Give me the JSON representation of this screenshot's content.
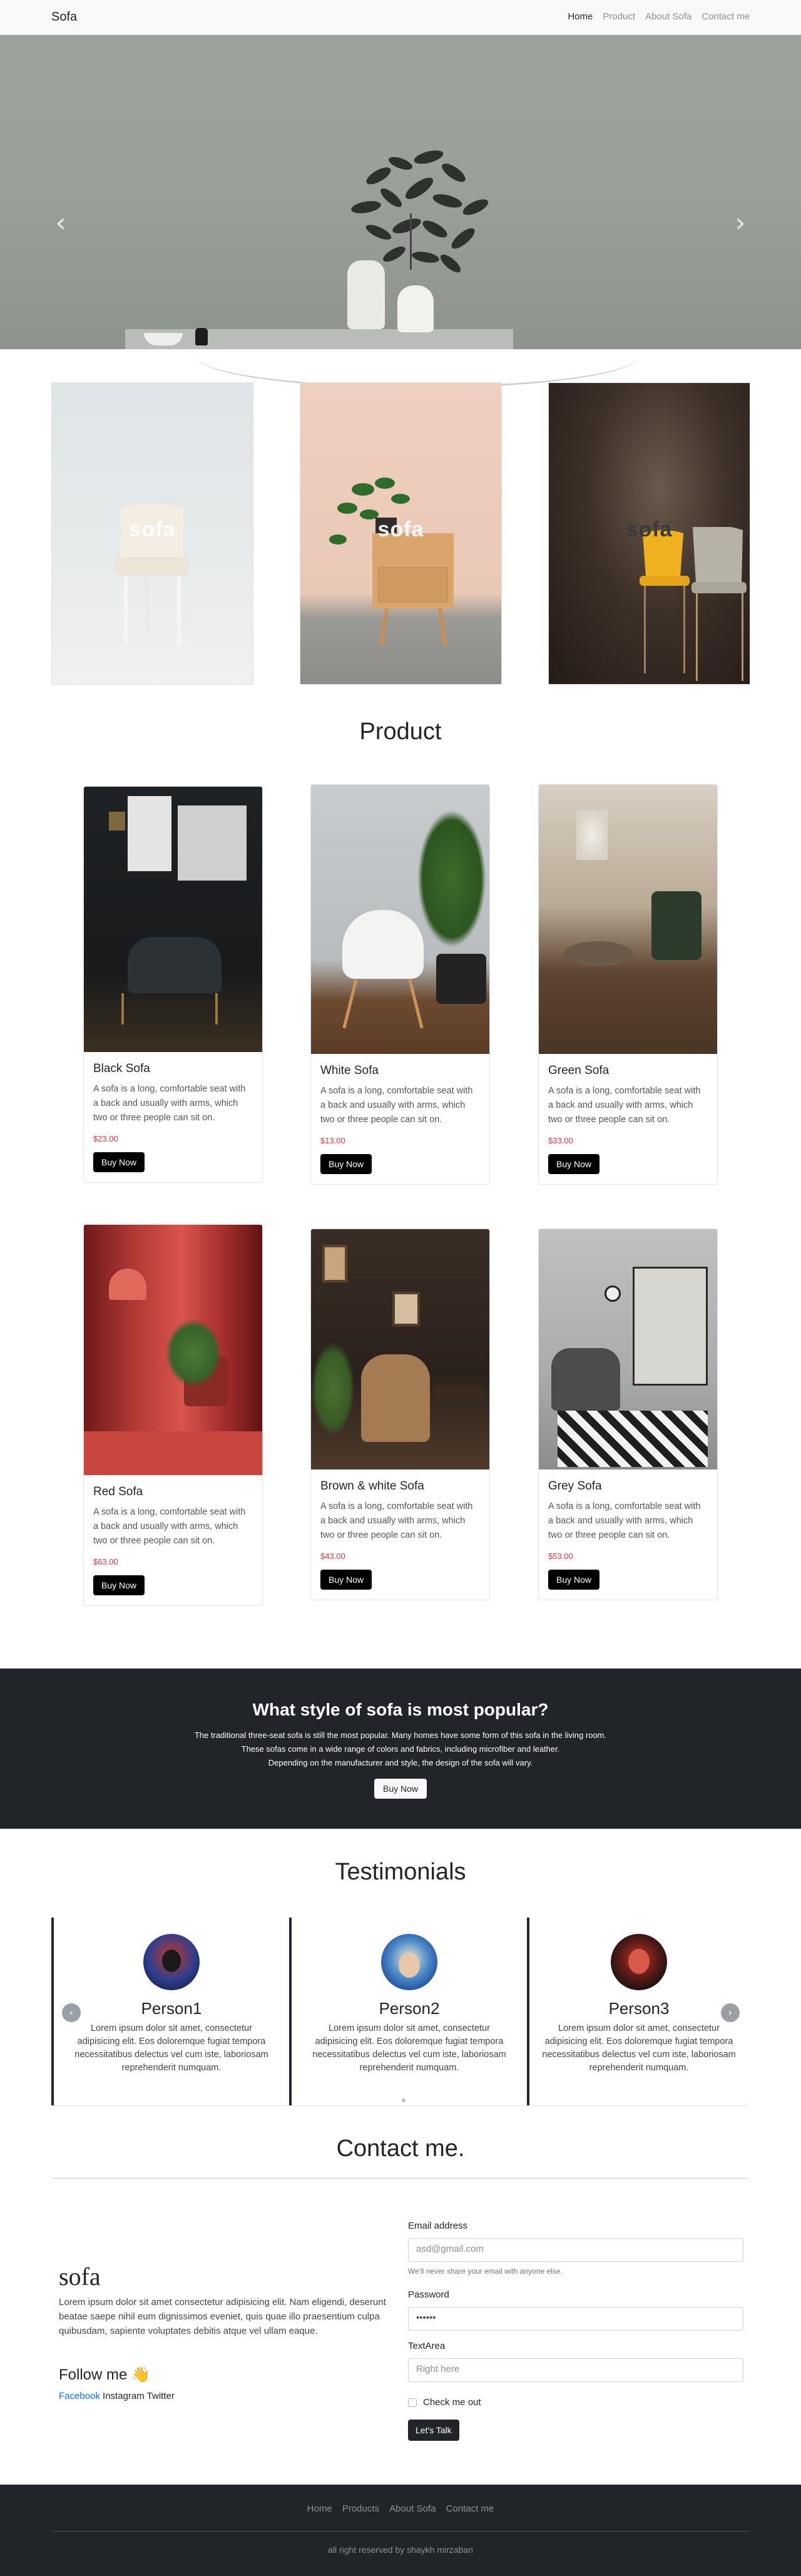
{
  "nav": {
    "brand": "Sofa",
    "links": [
      "Home",
      "Product",
      "About Sofa",
      "Contact me"
    ]
  },
  "hero": {
    "prev_icon": "chevron-left-icon",
    "next_icon": "chevron-right-icon",
    "slides": 4,
    "active_slide": 1
  },
  "categories": [
    {
      "label": "sofa"
    },
    {
      "label": "sofa"
    },
    {
      "label": "sofa"
    }
  ],
  "product": {
    "title": "Product",
    "items": [
      {
        "name": "Black Sofa",
        "desc": "A sofa is a long, comfortable seat with a back and usually with arms, which two or three people can sit on.",
        "price": "$23.00",
        "button": "Buy Now"
      },
      {
        "name": "White Sofa",
        "desc": "A sofa is a long, comfortable seat with a back and usually with arms, which two or three people can sit on.",
        "price": "$13.00",
        "button": "Buy Now"
      },
      {
        "name": "Green Sofa",
        "desc": "A sofa is a long, comfortable seat with a back and usually with arms, which two or three people can sit on.",
        "price": "$33.00",
        "button": "Buy Now"
      },
      {
        "name": "Red Sofa",
        "desc": "A sofa is a long, comfortable seat with a back and usually with arms, which two or three people can sit on.",
        "price": "$63.00",
        "button": "Buy Now"
      },
      {
        "name": "Brown & white Sofa",
        "desc": "A sofa is a long, comfortable seat with a back and usually with arms, which two or three people can sit on.",
        "price": "$43.00",
        "button": "Buy Now"
      },
      {
        "name": "Grey Sofa",
        "desc": "A sofa is a long, comfortable seat with a back and usually with arms, which two or three people can sit on.",
        "price": "$53.00",
        "button": "Buy Now"
      }
    ]
  },
  "banner": {
    "title": "What style of sofa is most popular?",
    "line1": "The traditional three-seat sofa is still the most popular. Many homes have some form of this sofa in the living room.",
    "line2": "These sofas come in a wide range of colors and fabrics, including microfiber and leather.",
    "line3": "Depending on the manufacturer and style, the design of the sofa will vary.",
    "button": "Buy Now"
  },
  "testimonials": {
    "title": "Testimonials",
    "items": [
      {
        "name": "Person1",
        "text": "Lorem ipsum dolor sit amet, consectetur adipisicing elit. Eos doloremque fugiat tempora necessitatibus delectus vel cum iste, laboriosam reprehenderit numquam."
      },
      {
        "name": "Person2",
        "text": "Lorem ipsum dolor sit amet, consectetur adipisicing elit. Eos doloremque fugiat tempora necessitatibus delectus vel cum iste, laboriosam reprehenderit numquam."
      },
      {
        "name": "Person3",
        "text": "Lorem ipsum dolor sit amet, consectetur adipisicing elit. Eos doloremque fugiat tempora necessitatibus delectus vel cum iste, laboriosam reprehenderit numquam."
      }
    ]
  },
  "contact": {
    "title": "Contact me.",
    "brand": "sofa",
    "text": "Lorem ipsum dolor sit amet consectetur adipisicing elit. Nam eligendi, deserunt beatae saepe nihil eum dignissimos eveniet, quis quae illo praesentium culpa quibusdam, sapiente voluptates debitis atque vel ullam eaque.",
    "follow": "Follow me 👋",
    "socials": [
      "Facebook",
      "Instagram",
      "Twitter"
    ],
    "email_label": "Email address",
    "email_placeholder": "asd@gmail.com",
    "email_help": "We'll never share your email with anyone else.",
    "password_label": "Password",
    "password_value": "••••••",
    "textarea_label": "TextArea",
    "textarea_placeholder": "Right here",
    "check_label": "Check me out",
    "submit": "Let's Talk"
  },
  "footer": {
    "links": [
      "Home",
      "Products",
      "About Sofa",
      "Contact me"
    ],
    "copyright": "all right reserved by shaykh mirzaban"
  }
}
